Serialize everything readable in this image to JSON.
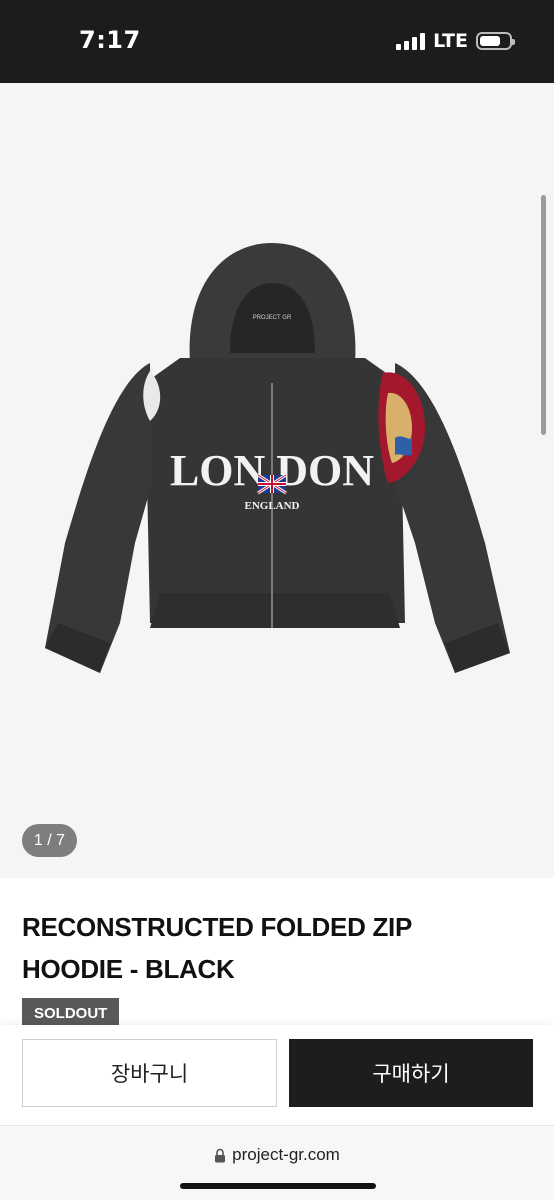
{
  "status_bar": {
    "time": "7:17",
    "network": "LTE",
    "battery_level": 0.7
  },
  "gallery": {
    "counter": "1 / 7",
    "image_text": {
      "brand_small": "PROJECT GR",
      "chest_main": "LON DON",
      "chest_sub": "ENGLAND"
    }
  },
  "product": {
    "title_line1": "RECONSTRUCTED FOLDED ZIP",
    "title_line2": "HOODIE - BLACK",
    "status_badge": "SOLDOUT"
  },
  "actions": {
    "cart_label": "장바구니",
    "buy_label": "구매하기"
  },
  "browser": {
    "url": "project-gr.com"
  },
  "colors": {
    "status_bar_bg": "#1c1c1c",
    "gallery_bg": "#f5f5f5",
    "hoodie": "#333333",
    "buy_button_bg": "#1d1d1d",
    "badge_bg": "#595959"
  }
}
